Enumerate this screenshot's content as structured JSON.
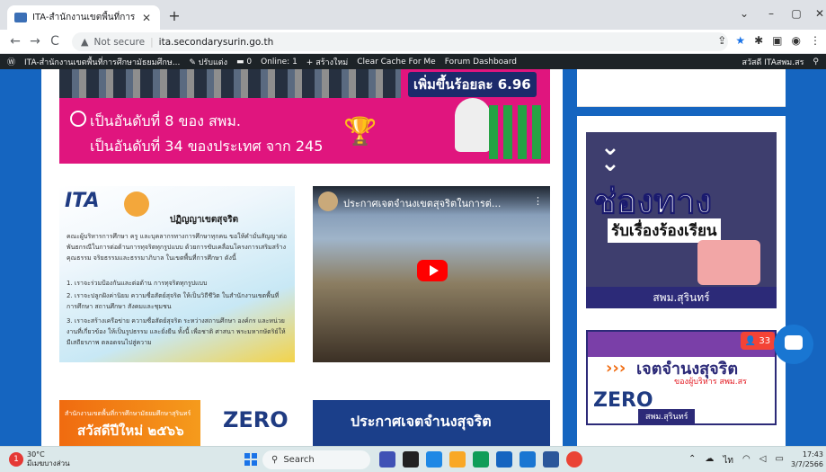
{
  "browser": {
    "tab_title": "ITA-สำนักงานเขตพื้นที่การศึกษามัธยม...",
    "not_secure": "Not secure",
    "url": "ita.secondarysurin.go.th"
  },
  "adminbar": {
    "site": "ITA-สำนักงานเขตพื้นที่การศึกษามัธยมศึกษ...",
    "customize": "ปรับแต่ง",
    "comments": "0",
    "online": "Online: 1",
    "new": "สร้างใหม่",
    "clear_cache": "Clear Cache For Me",
    "forum": "Forum Dashboard",
    "user": "สวัสดี ITAสพม.สร"
  },
  "banner1": {
    "increase": "เพิ่มขึ้นร้อยละ 6.96",
    "line1": "เป็นอันดับที่ 8 ของ สพม.",
    "line2": "เป็นอันดับที่ 34 ของประเทศ จาก 245"
  },
  "ita": {
    "logo_a": "ITA",
    "logo_b": "",
    "heading": "ปฏิญญาเขตสุจริต",
    "para1": "คณะผู้บริหารการศึกษา ครู และบุคลากรทางการศึกษาทุกคน ขอให้คำมั่นสัญญาต่อพันธกรณีในการต่อต้านการทุจริตทุกรูปแบบ ด้วยการขับเคลื่อนโครงการเสริมสร้างคุณธรรม จริยธรรมและธรรมาภิบาล ในเขตพื้นที่การศึกษา ดังนี้",
    "item1": "1. เราจะร่วมป้องกันและต่อต้าน การทุจริตทุกรูปแบบ",
    "item2": "2. เราจะปลูกฝังค่านิยม ความซื่อสัตย์สุจริต ให้เป็นวิถีชีวิต ในสำนักงานเขตพื้นที่การศึกษา สถานศึกษา สังคมและชุมชน",
    "item3": "3. เราจะสร้างเครือข่าย ความซื่อสัตย์สุจริต ระหว่างสถานศึกษา องค์กร และหน่วยงานที่เกี่ยวข้อง ให้เป็นรูปธรรม และยั่งยืน ทั้งนี้ เพื่อชาติ ศาสนา พระมหากษัตริย์ให้มีเสถียรภาพ ตลอดจนไปสู่ความ"
  },
  "video": {
    "title": "ประกาศเจตจำนงเขตสุจริตในการต่..."
  },
  "banner3": {
    "small": "สำนักงานเขตพื้นที่การศึกษามัธยมศึกษาสุรินทร์",
    "big": "สวัสดีปีใหม่ ๒๕๖๖",
    "zero": "ZERO"
  },
  "banner4": {
    "text": "ประกาศเจตจำนงสุจริต"
  },
  "side": {
    "card1_big": "ช่องทาง",
    "card1_sub": "รับเรื่องร้องเรียน",
    "card1_foot": "สพม.สุรินทร์",
    "card2_title": "เจตจำนงสุจริต",
    "card2_sub": "ของผู้บริหาร สพม.สร",
    "card2_zero": "ZERO",
    "card2_foot": "สพม.สุรินทร์"
  },
  "badge_count": "33",
  "taskbar": {
    "temp": "30°C",
    "weather": "มีเมฆบางส่วน",
    "search": "Search",
    "time": "17:43",
    "date": "3/7/2566"
  }
}
